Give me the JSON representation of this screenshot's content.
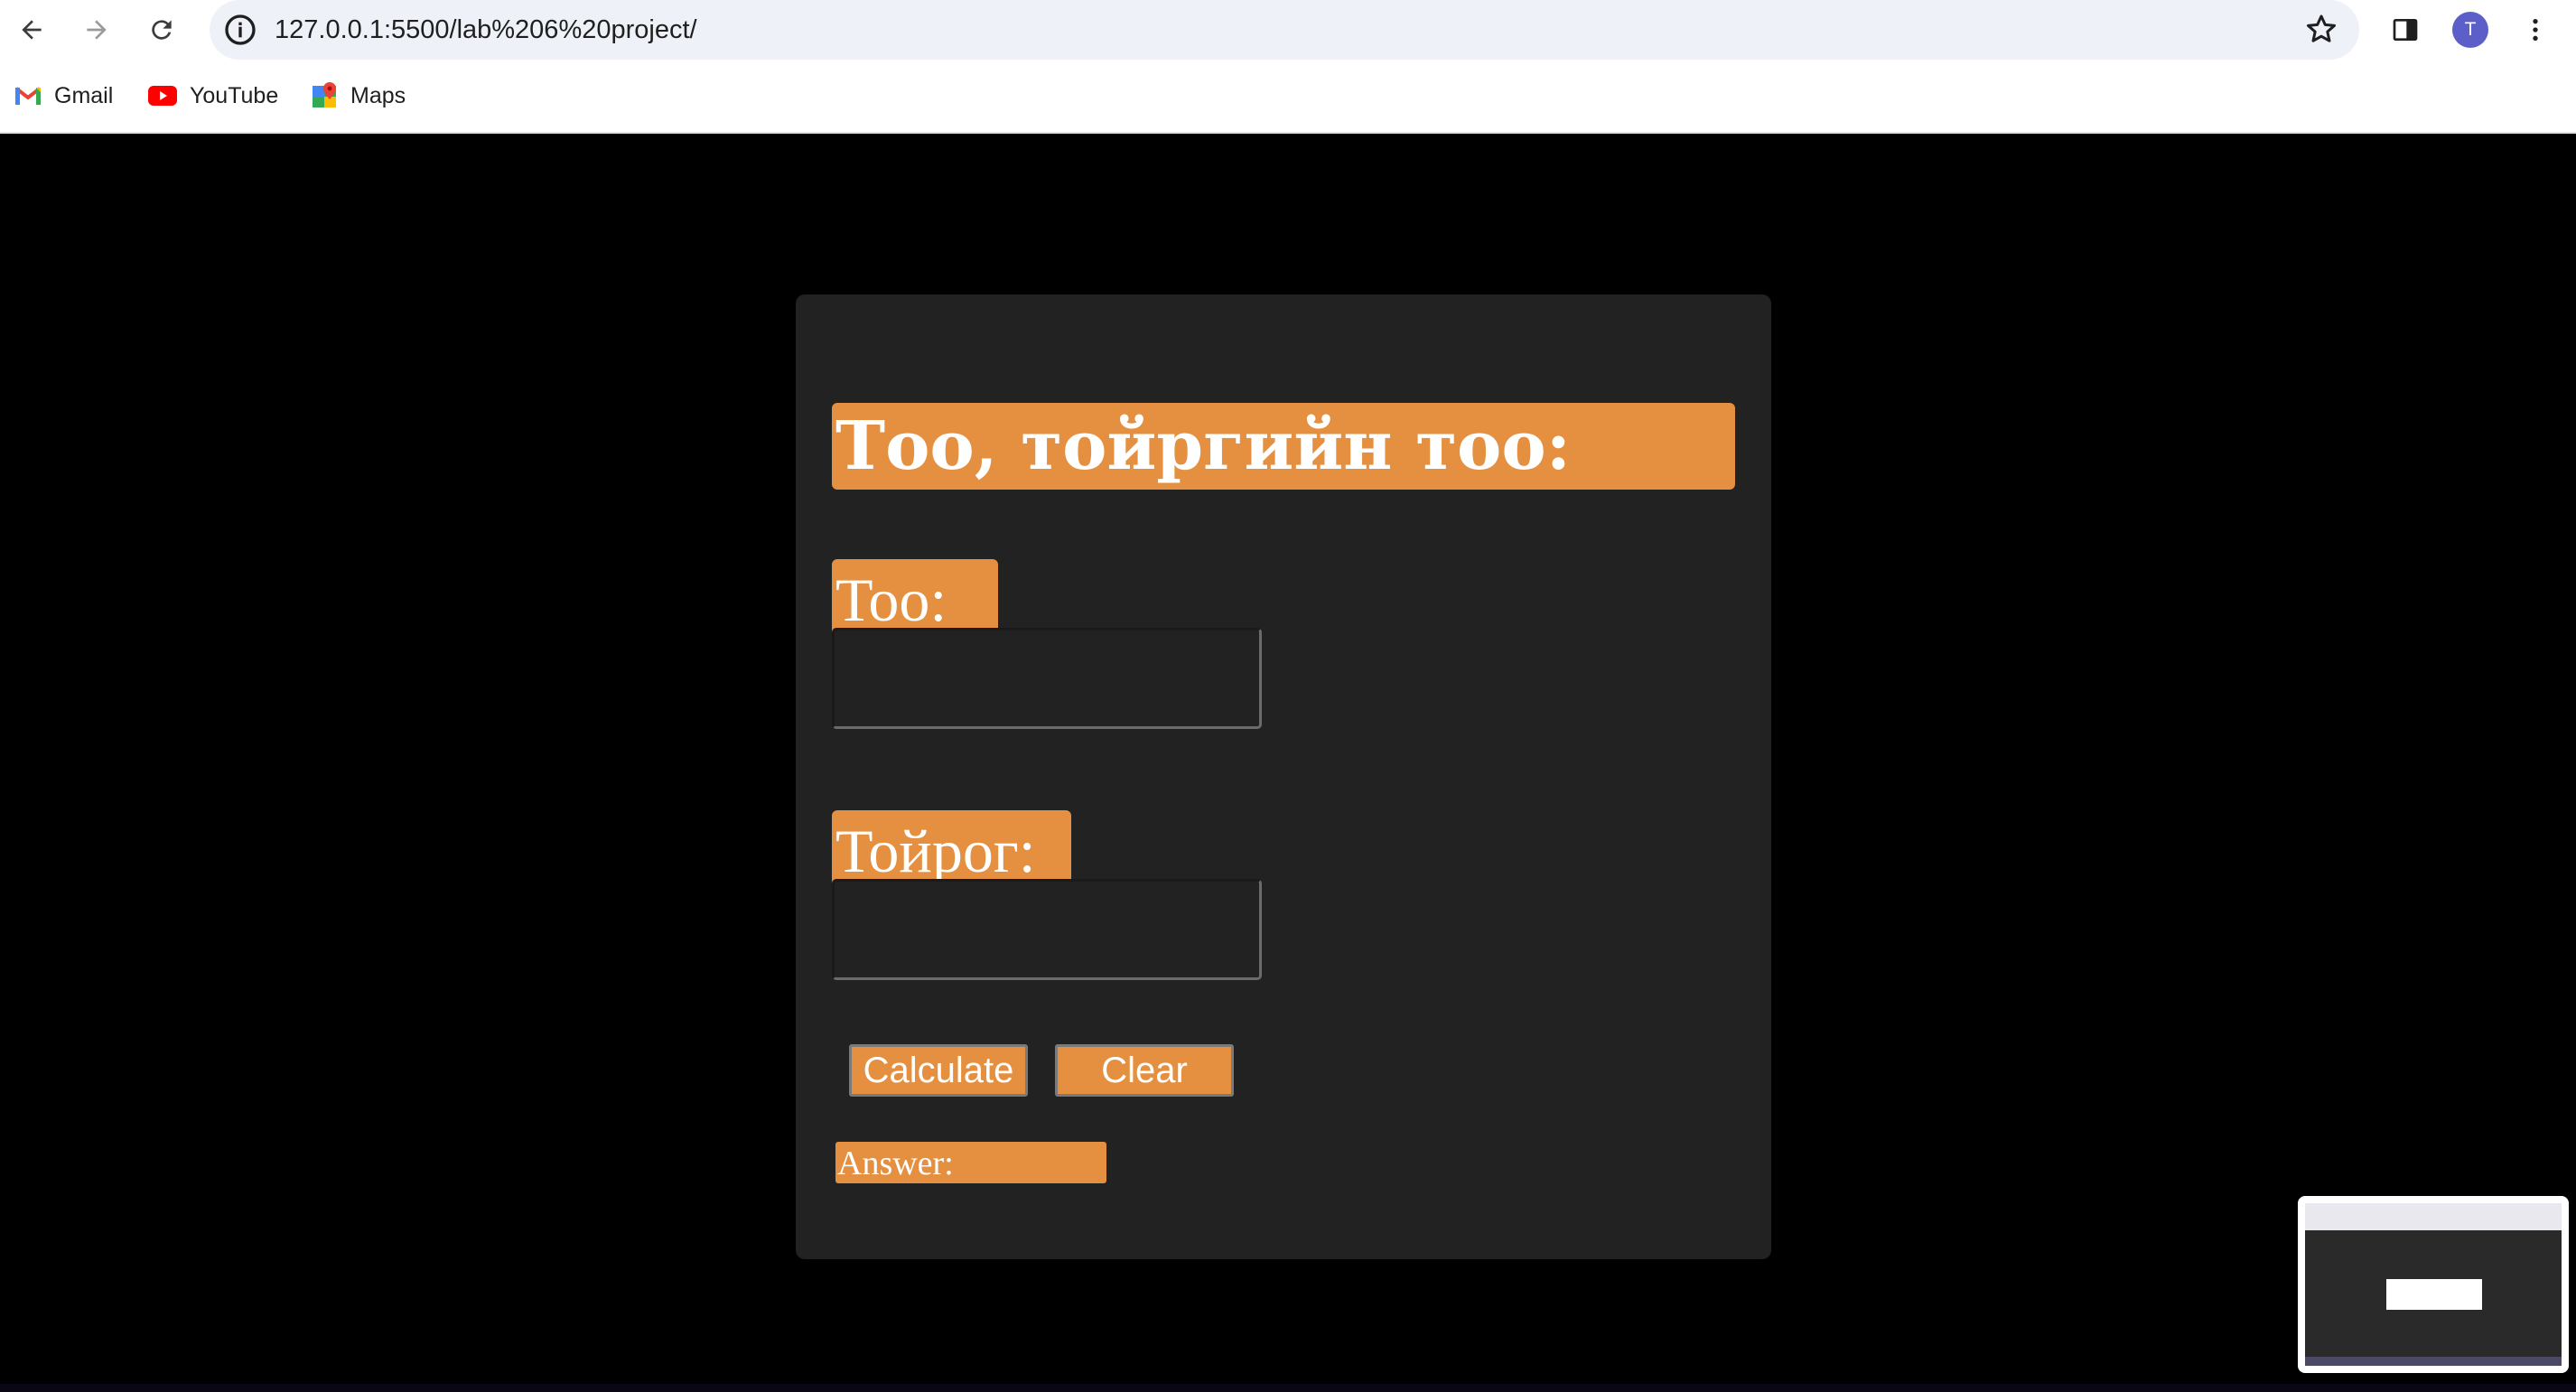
{
  "browser": {
    "url": "127.0.0.1:5500/lab%206%20project/",
    "avatar_letter": "T",
    "bookmarks": [
      {
        "label": "Gmail",
        "icon": "gmail-icon"
      },
      {
        "label": "YouTube",
        "icon": "youtube-icon"
      },
      {
        "label": "Maps",
        "icon": "maps-icon"
      }
    ]
  },
  "page": {
    "heading": "Тоо, тойргийн тоо:",
    "number_label": "Тоо:",
    "number_value": "",
    "round_label": "Тойрог:",
    "round_value": "",
    "calculate_label": "Calculate",
    "clear_label": "Clear",
    "answer_label": "Answer:"
  },
  "colors": {
    "page_background": "#000000",
    "card_background": "#222222",
    "accent": "#e49040",
    "text": "#ffffff"
  }
}
